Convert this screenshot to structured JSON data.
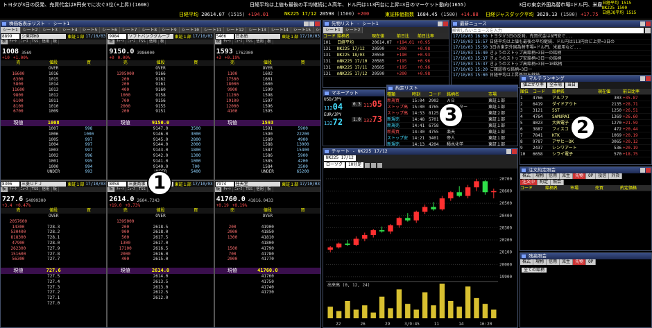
{
  "ticker": {
    "news": [
      "トヨタが3日の反発、売買代金は8円安でに次ぐ3位(+上昇)(1608)",
      "日経平均は上値も最後の平均継続にＡ高年、ドル円は113円台に上昇=3日のマーケット動向(1655)",
      "3日の東京外国為替市場=ドル円、米雇用統計"
    ],
    "indexes": [
      {
        "label": "日経平均",
        "value": "20614.07",
        "sub": "(1515)",
        "chg": "+194.01"
      },
      {
        "label": "NK225 17/12",
        "value": "20590",
        "sub": "(1500)",
        "chg": "+200"
      },
      {
        "label": "東証株価指数",
        "value": "1684.45",
        "sub": "(1500)",
        "chg": "+14.88"
      },
      {
        "label": "日経ジャスダック平均",
        "value": "3629.13",
        "sub": "(1500)",
        "chg": "+17.75"
      }
    ],
    "right_box": [
      "日経平均 1515",
      "NK225 1500",
      "日経JQ平均 1515"
    ]
  },
  "left_window": {
    "title": "株価板表示リスト - シート1",
    "toolbar": [
      "登録解除",
      "板",
      "ｱｸ",
      "ﾆｭｰｽ",
      "TSS",
      "信用",
      "板",
      "信用",
      "リスト",
      "ボード",
      "ｼｰﾄ名変更"
    ],
    "sheet_tabs": [
      "シート1",
      "シート2",
      "シート3",
      "シート4",
      "シート5",
      "シート6",
      "シート7",
      "シート8",
      "シート9",
      "シート10",
      "シート11",
      "シート12",
      "シート13",
      "シート14",
      "シート15",
      "シート16",
      "シート17"
    ],
    "boards": [
      {
        "code": "8899",
        "name": "シ東邦HD",
        "market": "東証１部",
        "date": "17/10/03",
        "price": "1008",
        "vol": "3569",
        "chg": "+10",
        "pct": "+1.00%",
        "asks": [
          [
            "",
            "OVER",
            ""
          ],
          [
            "16600",
            "1016",
            ""
          ],
          [
            "6300",
            "1015",
            ""
          ],
          [
            "5800",
            "1014",
            ""
          ],
          [
            "11600",
            "1013",
            ""
          ],
          [
            "9800",
            "1012",
            ""
          ],
          [
            "6100",
            "1011",
            ""
          ],
          [
            "8100",
            "1010",
            ""
          ],
          [
            "6700",
            "1009",
            ""
          ],
          [
            "",
            "",
            ""
          ]
        ],
        "bids": [
          [
            "",
            "1007",
            "998"
          ],
          [
            "",
            "1006",
            "1000"
          ],
          [
            "",
            "1005",
            "997"
          ],
          [
            "",
            "1004",
            "997"
          ],
          [
            "",
            "1003",
            "997"
          ],
          [
            "",
            "1002",
            "996"
          ],
          [
            "",
            "1001",
            "995"
          ],
          [
            "",
            "1000",
            "994"
          ],
          [
            "",
            "UNDER",
            "993"
          ]
        ],
        "current": "1008"
      },
      {
        "code": "9984",
        "name": "ソフトバンクグループ",
        "market": "東証１部",
        "date": "17/10/03",
        "price": "9150.0",
        "vol": "3986000",
        "chg": "+0",
        "pct": "0.00%",
        "asks": [
          [
            "",
            "OVER",
            ""
          ],
          [
            "1395000",
            "9166",
            ""
          ],
          [
            "200",
            "9162",
            ""
          ],
          [
            "200",
            "9161",
            ""
          ],
          [
            "400",
            "9160",
            ""
          ],
          [
            "1000",
            "9158",
            ""
          ],
          [
            "700",
            "9156",
            ""
          ],
          [
            "2000",
            "9155",
            ""
          ],
          [
            "200",
            "9151",
            ""
          ],
          [
            "",
            "",
            ""
          ]
        ],
        "bids": [
          [
            "",
            "9147.0",
            "3500"
          ],
          [
            "",
            "9146.0",
            "3000"
          ],
          [
            "",
            "9145.0",
            "2800"
          ],
          [
            "",
            "9144.0",
            "2000"
          ],
          [
            "",
            "9143.0",
            "1800"
          ],
          [
            "",
            "9142.0",
            "1300"
          ],
          [
            "",
            "9141.0",
            "1000"
          ],
          [
            "",
            "9140.0",
            "700"
          ],
          [
            "",
            "UNDER",
            "5400"
          ]
        ],
        "current": "9150.0"
      },
      {
        "code": "5406",
        "name": "日本紙",
        "market": "東証１部",
        "date": "17/10/03",
        "price": "1593",
        "vol": "1762300",
        "chg": "+3",
        "pct": "+0.19%",
        "asks": [
          [
            "",
            "OVER",
            ""
          ],
          [
            "1100",
            "1602",
            ""
          ],
          [
            "17500",
            "1601",
            ""
          ],
          [
            "18000",
            "1600",
            ""
          ],
          [
            "9900",
            "1599",
            ""
          ],
          [
            "11200",
            "1598",
            ""
          ],
          [
            "19100",
            "1597",
            ""
          ],
          [
            "12000",
            "1596",
            ""
          ],
          [
            "4100",
            "1595",
            ""
          ],
          [
            "",
            "",
            ""
          ]
        ],
        "bids": [
          [
            "",
            "1591",
            "5900"
          ],
          [
            "",
            "1590",
            "22200"
          ],
          [
            "",
            "1589",
            "4900"
          ],
          [
            "",
            "1588",
            "13000"
          ],
          [
            "",
            "1587",
            "15400"
          ],
          [
            "",
            "1586",
            "5900"
          ],
          [
            "",
            "1585",
            "4200"
          ],
          [
            "",
            "1584",
            "3500"
          ],
          [
            "",
            "UNDER",
            "65200"
          ]
        ],
        "current": "1593"
      },
      {
        "code": "8306",
        "name": "三菱ＵＦＪ",
        "market": "東証１部",
        "date": "17/10/03",
        "price": "727.6",
        "vol": "54099300",
        "chg": "+3.4",
        "pct": "+0.47%",
        "asks": [
          [
            "",
            "OVER",
            ""
          ],
          [
            "2057600",
            "",
            ""
          ],
          [
            "14300",
            "728.3",
            ""
          ],
          [
            "530400",
            "728.2",
            ""
          ],
          [
            "818300",
            "728.1",
            ""
          ],
          [
            "47900",
            "728.0",
            ""
          ],
          [
            "262300",
            "727.9",
            ""
          ],
          [
            "151600",
            "727.8",
            ""
          ],
          [
            "56300",
            "727.7",
            ""
          ],
          [
            "",
            "",
            ""
          ]
        ],
        "bids": [
          [
            "",
            "727.5",
            ""
          ],
          [
            "",
            "727.4",
            ""
          ],
          [
            "",
            "727.3",
            ""
          ],
          [
            "",
            "727.2",
            ""
          ],
          [
            "",
            "727.1",
            ""
          ],
          [
            "",
            "727.0",
            ""
          ],
          [
            "",
            "",
            ""
          ],
          [
            "",
            "",
            ""
          ],
          [
            "",
            "",
            ""
          ]
        ],
        "current": "727.6"
      },
      {
        "code": "8058",
        "name": "三菱商事",
        "market": "東証１部",
        "date": "17/10/03",
        "price": "2614.0",
        "vol": "2604.7243",
        "chg": "+19.0",
        "pct": "+0.73%",
        "asks": [
          [
            "",
            "OVER",
            ""
          ],
          [
            "1395000",
            "",
            ""
          ],
          [
            "200",
            "2618.5",
            ""
          ],
          [
            "900",
            "2618.0",
            ""
          ],
          [
            "500",
            "2617.5",
            ""
          ],
          [
            "1300",
            "2617.0",
            ""
          ],
          [
            "17100",
            "2616.5",
            ""
          ],
          [
            "2000",
            "2616.0",
            ""
          ],
          [
            "400",
            "2615.0",
            ""
          ],
          [
            "",
            "",
            ""
          ]
        ],
        "bids": [
          [
            "",
            "2614.0",
            ""
          ],
          [
            "",
            "2613.5",
            ""
          ],
          [
            "",
            "2613.0",
            ""
          ],
          [
            "",
            "2612.5",
            ""
          ],
          [
            "",
            "2612.0",
            ""
          ],
          [
            "",
            "",
            ""
          ],
          [
            "",
            "",
            ""
          ],
          [
            "",
            "",
            ""
          ],
          [
            "",
            "",
            ""
          ]
        ],
        "current": "2614.0"
      },
      {
        "code": "7974",
        "name": "任天堂",
        "market": "東証１部",
        "date": "17/10/03",
        "price": "41760.0",
        "vol": "41816.0433",
        "chg": "+0.19",
        "pct": "+0.19%",
        "asks": [
          [
            "",
            "OVER",
            ""
          ],
          [
            "",
            "",
            ""
          ],
          [
            "200",
            "41900",
            ""
          ],
          [
            "2000",
            "41850",
            ""
          ],
          [
            "1300",
            "41810",
            ""
          ],
          [
            "",
            "41800",
            ""
          ],
          [
            "1500",
            "41790",
            ""
          ],
          [
            "700",
            "41780",
            ""
          ],
          [
            "2000",
            "41770",
            ""
          ],
          [
            "",
            "",
            ""
          ]
        ],
        "bids": [
          [
            "",
            "41760",
            ""
          ],
          [
            "",
            "41750",
            ""
          ],
          [
            "",
            "41740",
            ""
          ],
          [
            "",
            "41730",
            ""
          ],
          [
            "",
            "",
            ""
          ],
          [
            "",
            "",
            ""
          ],
          [
            "",
            "",
            ""
          ],
          [
            "",
            "",
            ""
          ],
          [
            "",
            "",
            ""
          ]
        ],
        "current": "41760.0"
      }
    ],
    "col_headers": [
      "売",
      "値段",
      "買"
    ],
    "current_label": "現値"
  },
  "quote_list": {
    "title": "先物リスト - シート1",
    "headers": [
      "コード",
      "銘柄名",
      "現在値",
      "前日比",
      "前日比率"
    ],
    "rows": [
      [
        "101",
        "日経平均",
        "20614.07",
        "+194.01",
        "+0.95"
      ],
      [
        "131",
        "NK225 17/12",
        "20590",
        "+200",
        "+0.98"
      ],
      [
        "131",
        "NK225 18/03",
        "20550",
        "+190",
        "+0.93"
      ],
      [
        "131",
        "mNK225 17/10",
        "20585",
        "+195",
        "+0.96"
      ],
      [
        "131",
        "mNK225 17/11",
        "20585",
        "+195",
        "+0.96"
      ],
      [
        "131",
        "mNK225 17/12",
        "20590",
        "+200",
        "+0.98"
      ]
    ]
  },
  "news_window": {
    "title": "最新ニュース",
    "search_placeholder": "検索したいニュースを入力",
    "items": [
      [
        "17/10/03",
        "16:00",
        "トヨタが3日の反発、売買代金は8円安で..."
      ],
      [
        "17/10/03",
        "15:57",
        "日経平均は上値も最後の平均継続、ドル円は113円台に上昇=3日の"
      ],
      [
        "17/10/03",
        "15:50",
        "3日の東京外国為替市場=ドル円、米雇用など..."
      ],
      [
        "17/10/03",
        "15:40",
        "きょうのストップ高銘柄=3日一の銘柄"
      ],
      [
        "17/10/03",
        "15:37",
        "きょうのストップ安銘柄=3日一の銘柄"
      ],
      [
        "17/10/03",
        "15:37",
        "きょうのストップ高銘柄=3日一10銘柄"
      ],
      [
        "17/10/03",
        "15:20",
        "ご確認待ち銘柄=3日一"
      ],
      [
        "17/10/03",
        "15:00",
        "日経平均は上昇基調を継続"
      ]
    ]
  },
  "fx_window": {
    "title": "マネーアット",
    "pairs": [
      {
        "ccy": "USD/JPY",
        "bid_head": "112",
        "bid": "04",
        "sp": "0.3",
        "ask_head": "113",
        "ask": "05"
      },
      {
        "ccy": "EUR/JPY",
        "bid_head": "132",
        "bid": "72",
        "sp": "1.0",
        "ask_head": "132",
        "ask": "73"
      }
    ]
  },
  "execution_list": {
    "title": "約定リスト",
    "headers": [
      "種類",
      "時刻",
      "コード",
      "銘柄名",
      "市場"
    ],
    "rows": [
      [
        "新規買",
        "15:04",
        "2902",
        "ＡＢ",
        "東証１部"
      ],
      [
        "ストップ高",
        "15:00",
        "4765",
        "フォスター",
        "東証１部"
      ],
      [
        "ストップ高",
        "14:53",
        "8125",
        "アルプス",
        "東証２部"
      ],
      [
        "新規売",
        "14:48",
        "5701",
        "日軽金",
        "東証１部"
      ],
      [
        "新規売",
        "14:41",
        "6758",
        "ソニー",
        "東証１部"
      ],
      [
        "新規買",
        "14:30",
        "4755",
        "楽天",
        "東証１部"
      ],
      [
        "ストップ安",
        "14:21",
        "3401",
        "帝人",
        "東証１部"
      ],
      [
        "新規売",
        "14:13",
        "4204",
        "積水化学",
        "東証１部"
      ],
      [
        "新規買",
        "14:00",
        "8316",
        "シナノHD",
        "東証１部"
      ]
    ]
  },
  "ranking": {
    "title": "マルチランキング",
    "selects": [
      "値上がり率",
      "全市場",
      "当日"
    ],
    "headers": [
      "順位",
      "コード",
      "銘柄名",
      "現在値",
      "前日比率"
    ],
    "rows": [
      [
        "1",
        "4766",
        "アルファ",
        "303",
        "+35.87"
      ],
      [
        "2",
        "6419",
        "ダイドアウト",
        "2135",
        "+28.71"
      ],
      [
        "3",
        "3121",
        "5ST",
        "1250",
        "+26.51"
      ],
      [
        "4",
        "4764",
        "SAMURAI",
        "1369",
        "+26.60"
      ],
      [
        "5",
        "8023",
        "大興電子",
        "1270",
        "+21.59"
      ],
      [
        "6",
        "3887",
        "フィスコ",
        "472",
        "+20.44"
      ],
      [
        "7",
        "7841",
        "KTK",
        "1069",
        "+20.19"
      ],
      [
        "8",
        "9787",
        "アサヒーDK",
        "3065",
        "+20.12"
      ],
      [
        "9",
        "2437",
        "シンワアート",
        "536",
        "+20.19"
      ],
      [
        "10",
        "6658",
        "シライ電子",
        "570",
        "+18.75"
      ]
    ]
  },
  "chart": {
    "title": "チャート - NK225 17/12",
    "symbol": "NK225 17/12",
    "type_select": "ローソク",
    "period_select": "10分足",
    "sub_label": "出来高 (0, 12, 24)",
    "yticks": [
      "20700",
      "20600",
      "20500",
      "20400",
      "20300",
      "20200",
      "20100",
      "20000",
      "19900"
    ],
    "xticks": [
      "22",
      "26",
      "29",
      "3/9:45",
      "11",
      "14",
      "16:20"
    ]
  },
  "order_window": {
    "title": "注文約定照会",
    "tabs": [
      "株式",
      "現物",
      "信用",
      "派生",
      "先物",
      "OP",
      "投信",
      "外貨"
    ],
    "sub_tabs": [
      "注文中",
      "約定",
      "照会"
    ],
    "headers": [
      "コード",
      "銘柄名",
      "市場",
      "売買",
      "約定価格"
    ]
  },
  "position_window": {
    "title": "残高照会",
    "tabs": [
      "株式",
      "現物",
      "信用",
      "派生",
      "先物",
      "OP"
    ],
    "button": "全ての銘柄"
  },
  "annotations": [
    "1",
    "2",
    "3"
  ],
  "chart_data": {
    "type": "bar",
    "series": [
      {
        "name": "candles",
        "ohlc": [
          [
            20120,
            20150,
            20100,
            20140
          ],
          [
            20140,
            20180,
            20130,
            20170
          ],
          [
            20170,
            20200,
            20150,
            20160
          ],
          [
            20160,
            20230,
            20150,
            20210
          ],
          [
            20210,
            20260,
            20190,
            20240
          ],
          [
            20240,
            20290,
            20220,
            20280
          ],
          [
            20280,
            20310,
            20260,
            20270
          ],
          [
            20270,
            20330,
            20250,
            20320
          ],
          [
            20320,
            20390,
            20300,
            20380
          ],
          [
            20380,
            20420,
            20350,
            20360
          ],
          [
            20360,
            20440,
            20340,
            20430
          ],
          [
            20430,
            20490,
            20410,
            20470
          ],
          [
            20470,
            20510,
            20440,
            20450
          ],
          [
            20450,
            20560,
            20440,
            20540
          ],
          [
            20540,
            20600,
            20520,
            20590
          ],
          [
            20590,
            20640,
            20550,
            20560
          ],
          [
            20560,
            20650,
            20540,
            20630
          ],
          [
            20630,
            20700,
            20600,
            20680
          ],
          [
            20680,
            20690,
            20570,
            20590
          ],
          [
            20590,
            20620,
            20540,
            20600
          ]
        ]
      },
      {
        "name": "volume",
        "values": [
          8,
          5,
          12,
          6,
          9,
          4,
          15,
          7,
          20,
          10,
          6,
          18,
          9,
          24,
          12,
          8,
          22,
          14,
          10,
          6
        ]
      }
    ],
    "ylim": [
      19900,
      20750
    ]
  }
}
